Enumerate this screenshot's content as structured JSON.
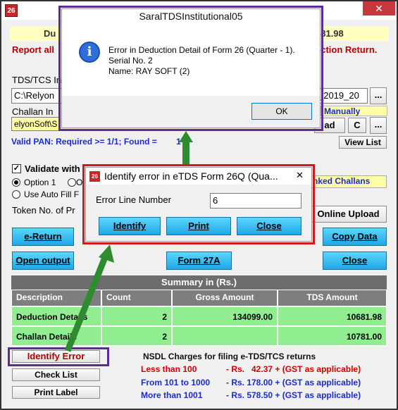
{
  "app": {
    "icon_text": "26",
    "close_glyph": "✕"
  },
  "banner": {
    "left": "Du",
    "right": "681.98"
  },
  "report": {
    "left": "Report all",
    "right": "ection Return."
  },
  "tds_label": "TDS/TCS In",
  "path_field": {
    "value": "C:\\Relyon",
    "right_value": "_2019_20"
  },
  "browse_label": "...",
  "challan": {
    "label": "Challan In",
    "field_value": "elyonSoft\\S",
    "manual_label": "Manually",
    "button_fragment": "ad",
    "c_label": "C"
  },
  "valid_pan": {
    "text": "Valid PAN: Required >= 1/1; Found = ",
    "value": "1"
  },
  "view_list": "View List",
  "validate": {
    "label": "Validate with",
    "checked": true
  },
  "options": {
    "option1": "Option 1",
    "option2_fragment": "O",
    "auto_fill": "Use Auto Fill F"
  },
  "linked_challans": "nked Challans",
  "token_label": "Token No. of Pr",
  "online_upload": "Online Upload",
  "buttons": {
    "ereturn": "e-Return",
    "open_output": "Open output",
    "form27a": "Form 27A",
    "copy_data": "Copy Data",
    "close": "Close",
    "identify_error": "Identify Error",
    "check_list": "Check List",
    "print_label": "Print Label"
  },
  "summary": {
    "title": "Summary in (Rs.)",
    "headers": [
      "Description",
      "Count",
      "Gross Amount",
      "TDS Amount"
    ],
    "rows": [
      {
        "description": "Deduction Details",
        "count": "2",
        "gross": "134099.00",
        "tds": "10681.98"
      },
      {
        "description": "Challan Details",
        "count": "2",
        "gross": "",
        "tds": "10781.00"
      }
    ]
  },
  "nsdl": {
    "title": "NSDL Charges for filing e-TDS/TCS returns",
    "rows": [
      {
        "range": "Less than 100",
        "charge": "- Rs.   42.37 + (GST as applicable)",
        "color": "#d10000"
      },
      {
        "range": "From 101 to 1000",
        "charge": "- Rs. 178.00 + (GST as applicable)",
        "color": "#1a2ad6"
      },
      {
        "range": "More than 1001",
        "charge": "- Rs. 578.50 + (GST as applicable)",
        "color": "#1a2ad6"
      }
    ]
  },
  "msgbox": {
    "title": "SaralTDSInstitutional05",
    "line1": "Error in Deduction Detail of Form 26 (Quarter - 1).",
    "line2": "Serial No. 2",
    "line3": "Name: RAY SOFT (2)",
    "ok": "OK",
    "info_glyph": "i"
  },
  "identify_dialog": {
    "title": "Identify error in eTDS Form 26Q (Qua...",
    "icon_text": "26",
    "close_glyph": "✕",
    "label": "Error Line Number",
    "value": "6",
    "identify": "Identify",
    "print": "Print",
    "close": "Close"
  },
  "colors": {
    "highlight_purple": "#5c2d91",
    "highlight_red": "#d11a1a",
    "arrow_green": "#2e8b30",
    "button_cyan": "#1fa8e6",
    "summary_green": "#90ee90"
  }
}
